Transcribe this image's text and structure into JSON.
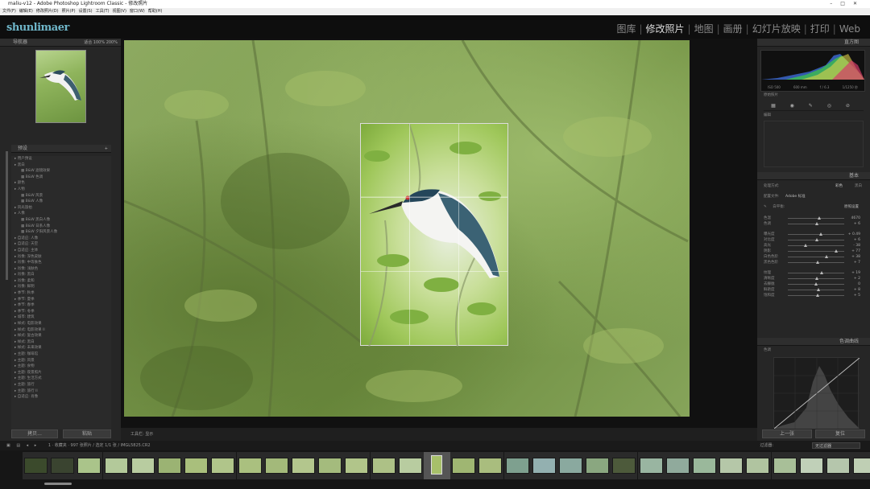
{
  "window": {
    "title": "maliu-v12 - Adobe Photoshop Lightroom Classic - 修改照片"
  },
  "menu": [
    "文件(F)",
    "编辑(E)",
    "修改照片(D)",
    "照片(P)",
    "设置(S)",
    "工具(T)",
    "视图(V)",
    "窗口(W)",
    "帮助(H)"
  ],
  "brand": {
    "logo": "shunlimaer"
  },
  "modules": [
    {
      "label": "图库",
      "active": false
    },
    {
      "label": "修改照片",
      "active": true
    },
    {
      "label": "地图",
      "active": false
    },
    {
      "label": "画册",
      "active": false
    },
    {
      "label": "幻灯片放映",
      "active": false
    },
    {
      "label": "打印",
      "active": false
    },
    {
      "label": "Web",
      "active": false
    }
  ],
  "left": {
    "navigator": {
      "title": "导航器",
      "zoom": [
        "适合",
        "100%",
        "200%"
      ]
    },
    "presets_title": "预设",
    "presets": [
      {
        "label": "用户预设",
        "sub": false
      },
      {
        "label": "黑白",
        "sub": false
      },
      {
        "label": "B&W 滤镜效果",
        "sub": true
      },
      {
        "label": "B&W 色调",
        "sub": true
      },
      {
        "label": "颜色",
        "sub": false
      },
      {
        "label": "人物",
        "sub": false
      },
      {
        "label": "B&W 风景",
        "sub": true
      },
      {
        "label": "B&W 人像",
        "sub": true
      },
      {
        "label": "风光旅拍",
        "sub": false
      },
      {
        "label": "人像",
        "sub": false
      },
      {
        "label": "B&W 黑白人像",
        "sub": true
      },
      {
        "label": "B&W 日系人像",
        "sub": true
      },
      {
        "label": "B&W 夕阳风景人像",
        "sub": true
      },
      {
        "label": "自适应: 人像",
        "sub": false
      },
      {
        "label": "自适应: 天空",
        "sub": false
      },
      {
        "label": "自适应: 主体",
        "sub": false
      },
      {
        "label": "肖像: 深色皮肤",
        "sub": false
      },
      {
        "label": "肖像: 中等肤色",
        "sub": false
      },
      {
        "label": "肖像: 浅肤色",
        "sub": false
      },
      {
        "label": "肖像: 黑白",
        "sub": false
      },
      {
        "label": "肖像: 柔和",
        "sub": false
      },
      {
        "label": "肖像: 鲜明",
        "sub": false
      },
      {
        "label": "季节: 秋季",
        "sub": false
      },
      {
        "label": "季节: 夏季",
        "sub": false
      },
      {
        "label": "季节: 春季",
        "sub": false
      },
      {
        "label": "季节: 冬季",
        "sub": false
      },
      {
        "label": "城市: 建筑",
        "sub": false
      },
      {
        "label": "样式: 电影效果",
        "sub": false
      },
      {
        "label": "样式: 电影效果 II",
        "sub": false
      },
      {
        "label": "样式: 复古效果",
        "sub": false
      },
      {
        "label": "样式: 黑白",
        "sub": false
      },
      {
        "label": "样式: 未来效果",
        "sub": false
      },
      {
        "label": "主题: 咖啡馆",
        "sub": false
      },
      {
        "label": "主题: 风景",
        "sub": false
      },
      {
        "label": "主题: 食物",
        "sub": false
      },
      {
        "label": "主题: 夜景照片",
        "sub": false
      },
      {
        "label": "主题: 生活方式",
        "sub": false
      },
      {
        "label": "主题: 旅行",
        "sub": false
      },
      {
        "label": "主题: 旅行 II",
        "sub": false
      },
      {
        "label": "自适应: 肖像",
        "sub": false
      }
    ],
    "buttons": {
      "copy": "拷贝...",
      "paste": "粘贴"
    }
  },
  "toolbar": {
    "label": "工具栏: 显示"
  },
  "right": {
    "histogram": {
      "title": "直方图",
      "readout": [
        "ISO 500",
        "600 mm",
        "f / 6.3",
        "1/1250 秒"
      ],
      "note": "原始照片"
    },
    "tools_label": "编辑",
    "profile": {
      "label": "配置文件:",
      "value": "Adobe 标准"
    },
    "basic_title": "基本",
    "treatment": {
      "label": "处理方式:",
      "color": "彩色",
      "bw": "黑白"
    },
    "wb": {
      "label": "白平衡:",
      "value": "原照设置"
    },
    "sliders": [
      {
        "label": "色温",
        "value": "4670",
        "pos": 0.55
      },
      {
        "label": "色调",
        "value": "+ 6",
        "pos": 0.52
      },
      {
        "label": "曝光度",
        "value": "+ 0.49",
        "pos": 0.58
      },
      {
        "label": "对比度",
        "value": "+ 6",
        "pos": 0.52
      },
      {
        "label": "高光",
        "value": "- 38",
        "pos": 0.32
      },
      {
        "label": "阴影",
        "value": "+ 77",
        "pos": 0.85
      },
      {
        "label": "白色色阶",
        "value": "+ 38",
        "pos": 0.68
      },
      {
        "label": "黑色色阶",
        "value": "+ 7",
        "pos": 0.53
      },
      {
        "label": "纹理",
        "value": "+ 19",
        "pos": 0.6
      },
      {
        "label": "清晰度",
        "value": "+ 2",
        "pos": 0.51
      },
      {
        "label": "去朦胧",
        "value": "0",
        "pos": 0.5
      },
      {
        "label": "鲜艳度",
        "value": "+ 8",
        "pos": 0.54
      },
      {
        "label": "饱和度",
        "value": "+ 5",
        "pos": 0.53
      }
    ],
    "tone_tab": "色调",
    "auto": "自动",
    "presence_title": "偏好",
    "curve_title": "色调曲线",
    "buttons": {
      "prev": "上一张",
      "reset": "复位"
    }
  },
  "filmbar": {
    "source": "1 · 收藏夹 · 997 张照片 / 选定 1/1 张 / IMGL5825.CR2",
    "filter_label": "过滤器:",
    "filter_value": "无过滤器"
  },
  "filmstrip": {
    "cells": [
      {
        "num": "",
        "tone": "#3b4a2c"
      },
      {
        "num": "",
        "tone": "#3a4430"
      },
      {
        "num": "",
        "tone": "#aac48a"
      },
      {
        "num": "",
        "tone": "#b3c99a"
      },
      {
        "num": "",
        "tone": "#b8cca0"
      },
      {
        "num": "",
        "tone": "#9bb373"
      },
      {
        "num": "",
        "tone": "#a9bf7c"
      },
      {
        "num": "",
        "tone": "#b0c58a"
      },
      {
        "num": "",
        "tone": "#aac07f"
      },
      {
        "num": "",
        "tone": "#a3b97a"
      },
      {
        "num": "",
        "tone": "#b3c68d"
      },
      {
        "num": "",
        "tone": "#a4bb7d"
      },
      {
        "num": "",
        "tone": "#b1c58a"
      },
      {
        "num": "",
        "tone": "#adc186"
      },
      {
        "num": "",
        "tone": "#b8cca0"
      },
      {
        "num": "",
        "tone": "#a7c06a"
      },
      {
        "num": "",
        "tone": "#9fb672"
      },
      {
        "num": "",
        "tone": "#a9bd7e"
      },
      {
        "num": "",
        "tone": "#7ea08f"
      },
      {
        "num": "",
        "tone": "#93b0b0"
      },
      {
        "num": "",
        "tone": "#8aa99f"
      },
      {
        "num": "",
        "tone": "#8aa780"
      },
      {
        "num": "",
        "tone": "#4d5a3b"
      },
      {
        "num": "",
        "tone": "#99b5a1"
      },
      {
        "num": "",
        "tone": "#90aa9c"
      },
      {
        "num": "",
        "tone": "#9ab89b"
      },
      {
        "num": "",
        "tone": "#b5c7a8"
      },
      {
        "num": "",
        "tone": "#b0c4a0"
      },
      {
        "num": "",
        "tone": "#a8bf98"
      },
      {
        "num": "",
        "tone": "#c0d0b8"
      },
      {
        "num": "",
        "tone": "#b5c6ac"
      },
      {
        "num": "",
        "tone": "#bfcfb4"
      }
    ]
  },
  "colors": {
    "accent": "#6fb6c9",
    "panel": "#262626",
    "photo_green": "#7e9a54"
  }
}
